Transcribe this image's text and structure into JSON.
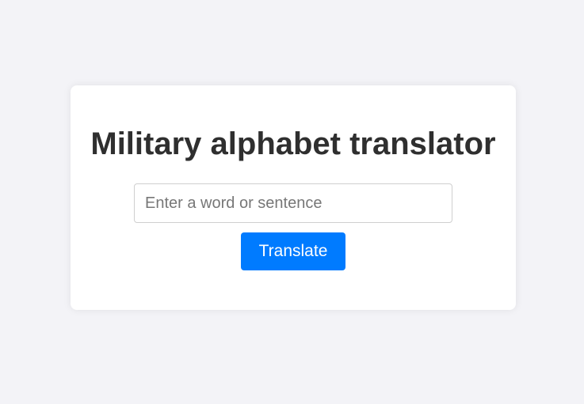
{
  "app": {
    "title": "Military alphabet translator"
  },
  "form": {
    "input_value": "",
    "input_placeholder": "Enter a word or sentence",
    "translate_label": "Translate"
  },
  "colors": {
    "background": "#f3f3f7",
    "card": "#ffffff",
    "title_text": "#2f2f2f",
    "button": "#007bff",
    "button_text": "#ffffff"
  }
}
